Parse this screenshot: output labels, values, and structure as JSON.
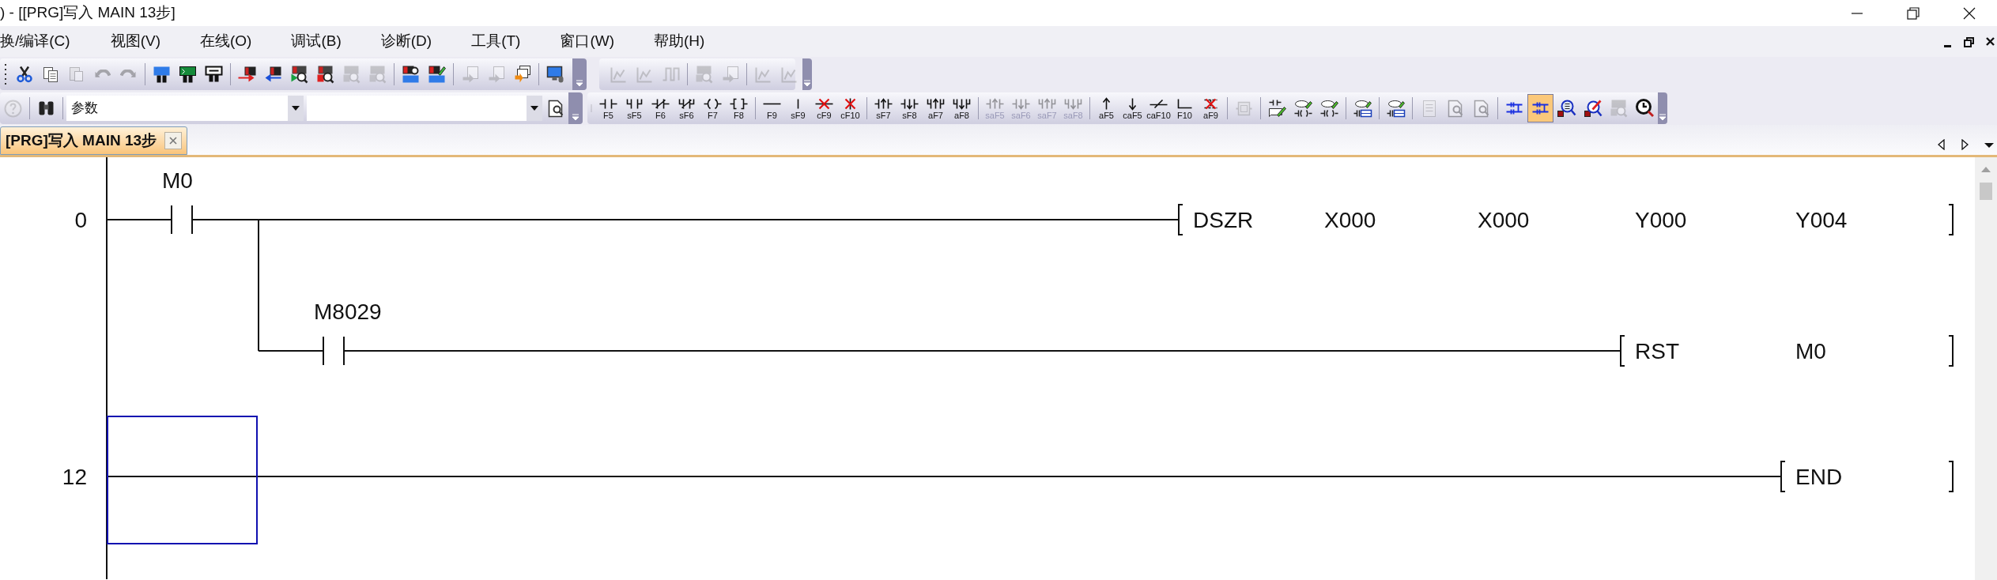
{
  "window": {
    "title": ") - [[PRG]写入 MAIN 13步]"
  },
  "menu": [
    "换/编译(C)",
    "视图(V)",
    "在线(O)",
    "调试(B)",
    "诊断(D)",
    "工具(T)",
    "窗口(W)",
    "帮助(H)"
  ],
  "toolbar_standard": [
    {
      "kind": "scissors",
      "disabled": false
    },
    {
      "kind": "copy",
      "disabled": false
    },
    {
      "kind": "paste",
      "disabled": true
    },
    {
      "kind": "undo",
      "disabled": true
    },
    {
      "kind": "redo",
      "disabled": true
    },
    {
      "kind": "separator"
    },
    {
      "kind": "device-blue",
      "disabled": false
    },
    {
      "kind": "device-green",
      "disabled": false
    },
    {
      "kind": "device-chip",
      "disabled": false
    },
    {
      "kind": "separator"
    },
    {
      "kind": "write",
      "disabled": false
    },
    {
      "kind": "read",
      "disabled": false
    },
    {
      "kind": "plc-search-green",
      "disabled": false
    },
    {
      "kind": "plc-search-red",
      "disabled": false
    },
    {
      "kind": "plc-search-gray",
      "disabled": true
    },
    {
      "kind": "plc-search-gray",
      "disabled": true
    },
    {
      "kind": "separator"
    },
    {
      "kind": "plc-blue",
      "disabled": false
    },
    {
      "kind": "plc-pencil",
      "disabled": false
    },
    {
      "kind": "separator"
    },
    {
      "kind": "page-arrow",
      "disabled": true
    },
    {
      "kind": "page-arrow",
      "disabled": true
    },
    {
      "kind": "pages-orange",
      "disabled": false
    },
    {
      "kind": "separator"
    },
    {
      "kind": "monitor",
      "disabled": false
    }
  ],
  "toolbar_sample": [
    {
      "kind": "chart",
      "disabled": true
    },
    {
      "kind": "chart",
      "disabled": true
    },
    {
      "kind": "wave",
      "disabled": true
    },
    {
      "kind": "separator"
    },
    {
      "kind": "plc-search-gray",
      "disabled": true
    },
    {
      "kind": "page-arrow",
      "disabled": true
    },
    {
      "kind": "separator"
    },
    {
      "kind": "chart",
      "disabled": true
    },
    {
      "kind": "chart",
      "disabled": true
    }
  ],
  "toolbar_search": [
    {
      "kind": "help",
      "disabled": true
    },
    {
      "kind": "separator"
    },
    {
      "kind": "binoculars",
      "disabled": false
    },
    {
      "kind": "separator"
    }
  ],
  "combos": [
    {
      "value": "参数"
    }
  ],
  "toolbar_ladder": [
    {
      "kind": "contact",
      "key": "F5",
      "disabled": false,
      "selected": false
    },
    {
      "kind": "contact-parallel",
      "key": "sF5",
      "disabled": false,
      "selected": false
    },
    {
      "kind": "contact-nc",
      "key": "F6",
      "disabled": false,
      "selected": false
    },
    {
      "kind": "contact-nc-parallel",
      "key": "sF6",
      "disabled": false,
      "selected": false
    },
    {
      "kind": "coil",
      "key": "F7",
      "disabled": false,
      "selected": false
    },
    {
      "kind": "function",
      "key": "F8",
      "disabled": false,
      "selected": false
    },
    {
      "kind": "separator"
    },
    {
      "kind": "hline",
      "key": "F9",
      "disabled": false,
      "selected": false
    },
    {
      "kind": "vline",
      "key": "sF9",
      "disabled": false,
      "selected": false
    },
    {
      "kind": "delete-hline",
      "key": "cF9",
      "disabled": false,
      "selected": false
    },
    {
      "kind": "delete-vline",
      "key": "cF10",
      "disabled": false,
      "selected": false
    },
    {
      "kind": "separator"
    },
    {
      "kind": "pulse-rise",
      "key": "sF7",
      "disabled": false,
      "selected": false
    },
    {
      "kind": "pulse-fall",
      "key": "sF8",
      "disabled": false,
      "selected": false
    },
    {
      "kind": "pulse-rise-parallel",
      "key": "aF7",
      "disabled": false,
      "selected": false
    },
    {
      "kind": "pulse-fall-parallel",
      "key": "aF8",
      "disabled": false,
      "selected": false
    },
    {
      "kind": "separator"
    },
    {
      "kind": "pulse-rise",
      "key": "saF5",
      "disabled": true,
      "selected": false
    },
    {
      "kind": "pulse-fall",
      "key": "saF6",
      "disabled": true,
      "selected": false
    },
    {
      "kind": "pulse-rise-parallel",
      "key": "saF7",
      "disabled": true,
      "selected": false
    },
    {
      "kind": "pulse-fall-parallel",
      "key": "saF8",
      "disabled": true,
      "selected": false
    },
    {
      "kind": "separator"
    },
    {
      "kind": "arrow-up",
      "key": "aF5",
      "disabled": false,
      "selected": false
    },
    {
      "kind": "arrow-down",
      "key": "caF5",
      "disabled": false,
      "selected": false
    },
    {
      "kind": "invert",
      "key": "caF10",
      "disabled": false,
      "selected": false
    },
    {
      "kind": "corner",
      "key": "F10",
      "disabled": false,
      "selected": false
    },
    {
      "kind": "delete-corner",
      "key": "aF9",
      "disabled": false,
      "selected": false
    },
    {
      "kind": "separator"
    },
    {
      "kind": "st-block",
      "disabled": true,
      "selected": false
    },
    {
      "kind": "separator"
    },
    {
      "kind": "comment-contact",
      "disabled": false,
      "selected": false
    },
    {
      "kind": "comment-coil",
      "disabled": false,
      "selected": false
    },
    {
      "kind": "comment-coil",
      "disabled": false,
      "selected": false
    },
    {
      "kind": "separator"
    },
    {
      "kind": "comment-table",
      "disabled": false,
      "selected": false
    },
    {
      "kind": "separator"
    },
    {
      "kind": "comment-table",
      "disabled": false,
      "selected": false
    },
    {
      "kind": "separator"
    },
    {
      "kind": "page-list",
      "disabled": true,
      "selected": false
    },
    {
      "kind": "page-search",
      "disabled": true,
      "selected": false
    },
    {
      "kind": "page-search",
      "disabled": true,
      "selected": false
    },
    {
      "kind": "separator"
    },
    {
      "kind": "ladder-tree",
      "disabled": false,
      "selected": false
    },
    {
      "kind": "ladder-tree",
      "disabled": false,
      "selected": true
    },
    {
      "kind": "search-doc",
      "disabled": false,
      "selected": false
    },
    {
      "kind": "search-pencil",
      "disabled": false,
      "selected": false
    },
    {
      "kind": "plc-search-gray",
      "disabled": true,
      "selected": false
    },
    {
      "kind": "zoom",
      "disabled": false,
      "selected": false
    }
  ],
  "tabs": [
    {
      "label": "[PRG]写入 MAIN 13步",
      "selected": true
    }
  ],
  "ladder": {
    "rungs": [
      {
        "step": "0",
        "selected": false,
        "contacts": [
          {
            "device": "M0"
          }
        ],
        "instruction": [
          "DSZR",
          "X000",
          "X000",
          "Y000",
          "Y004"
        ],
        "branch": {
          "contacts": [
            {
              "device": "M8029"
            }
          ],
          "instruction": [
            "RST",
            "M0"
          ]
        }
      },
      {
        "step": "12",
        "selected": true,
        "instruction": [
          "END"
        ]
      }
    ]
  }
}
